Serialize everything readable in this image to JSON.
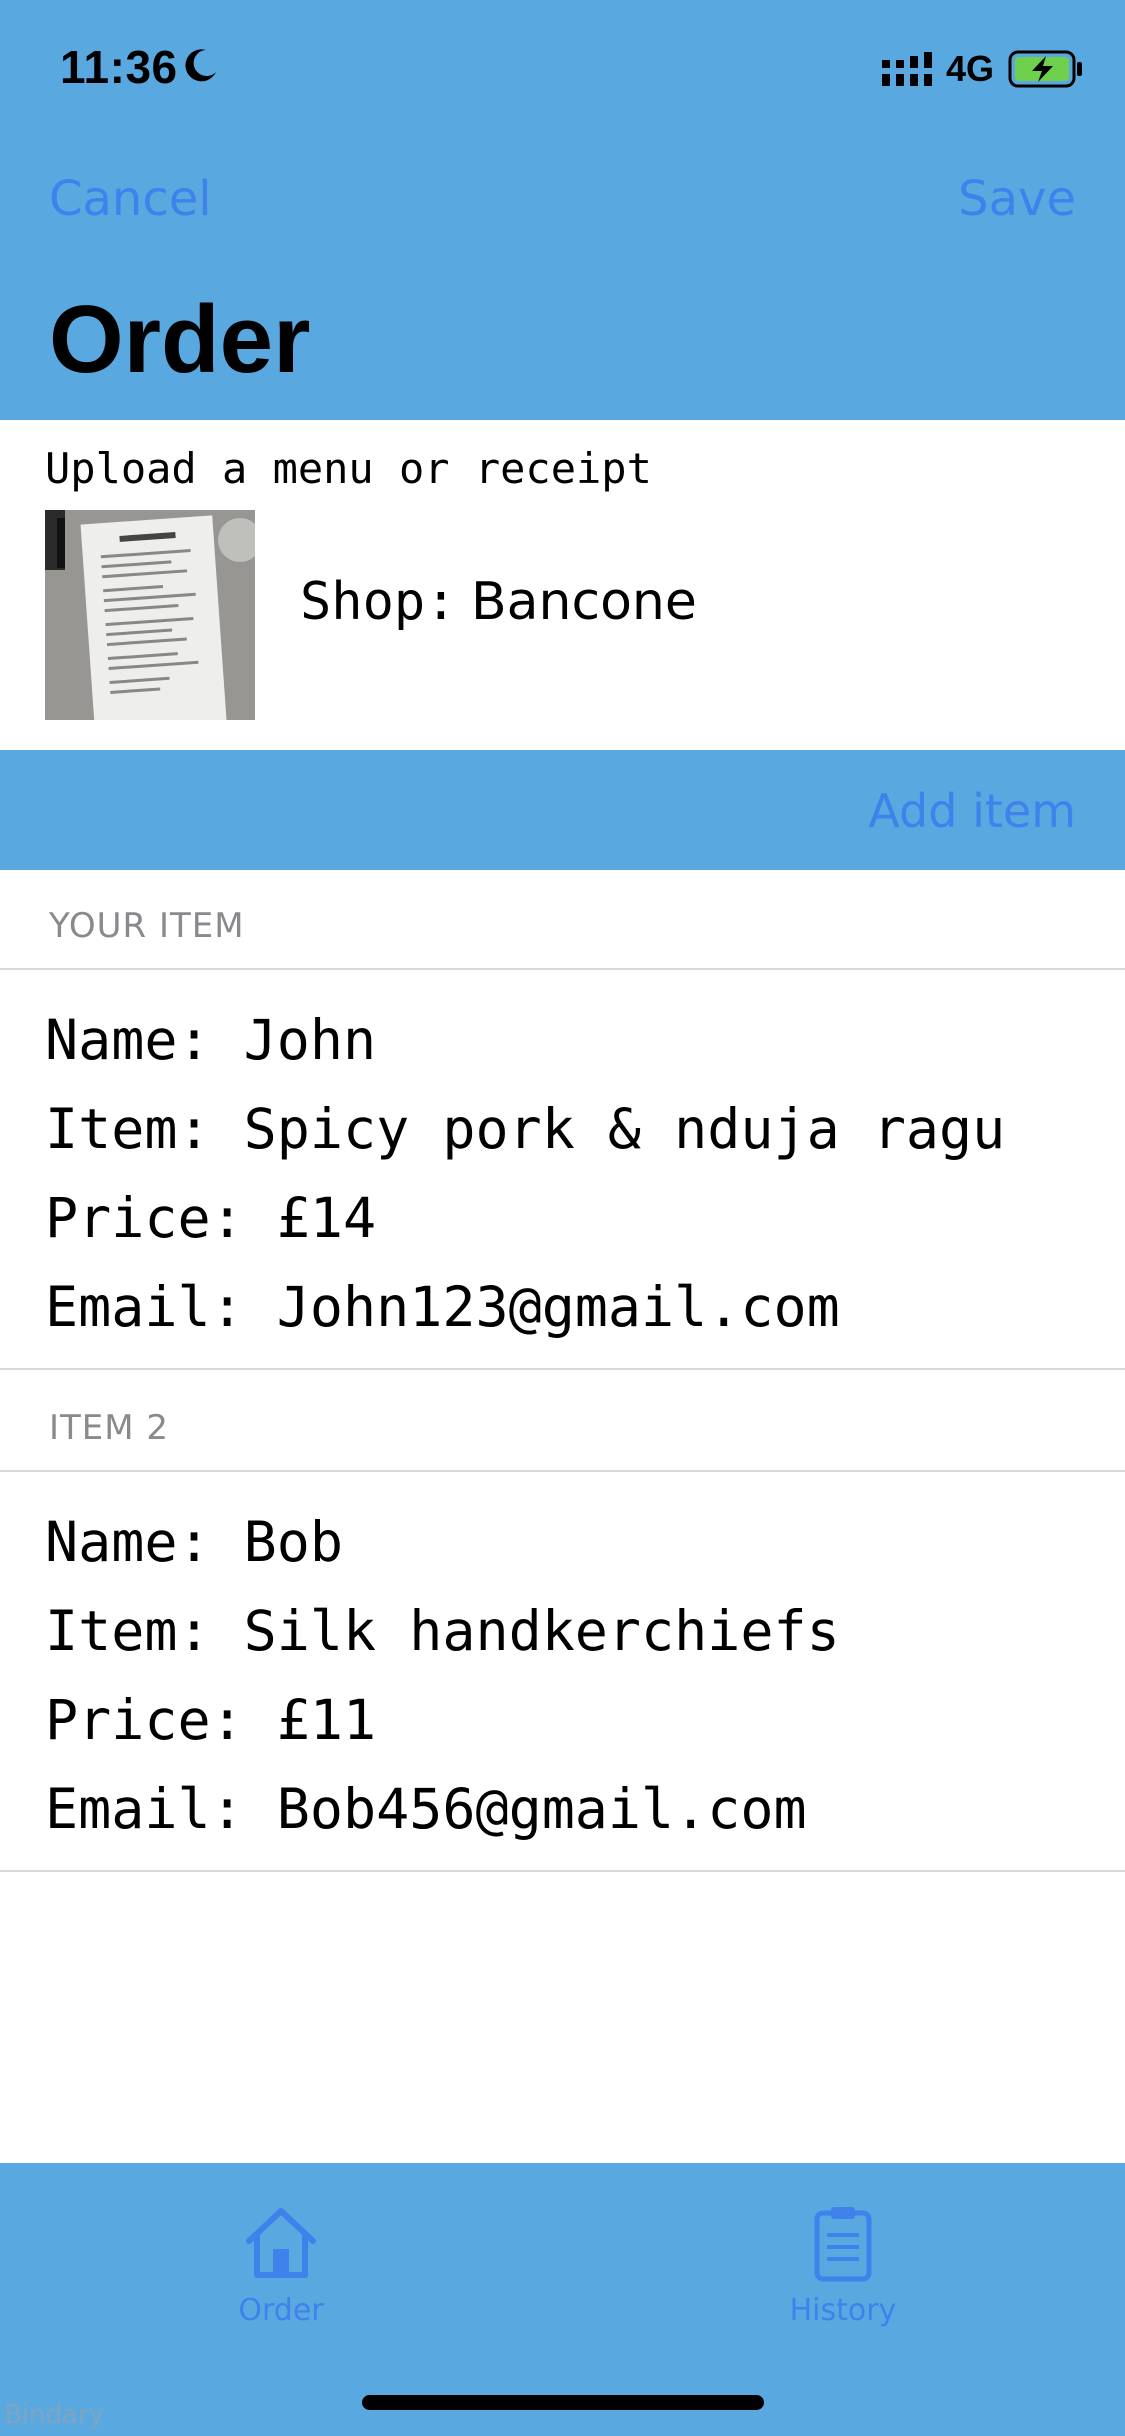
{
  "status_bar": {
    "time": "11:36",
    "network": "4G",
    "icons": [
      "moon-icon",
      "signal-icon",
      "battery-charging-icon"
    ]
  },
  "nav": {
    "cancel_label": "Cancel",
    "save_label": "Save",
    "title": "Order"
  },
  "upload": {
    "label": "Upload a menu or receipt",
    "shop_label": "Shop:",
    "shop_value": "Bancone"
  },
  "add_item_label": "Add item",
  "items": [
    {
      "header": "YOUR ITEM",
      "name": "Name: John",
      "item": "Item: Spicy pork & nduja ragu",
      "price": "Price: £14",
      "email": "Email: John123@gmail.com"
    },
    {
      "header": "ITEM 2",
      "name": "Name: Bob",
      "item": "Item: Silk handkerchiefs",
      "price": "Price: £11",
      "email": "Email: Bob456@gmail.com"
    }
  ],
  "tabs": [
    {
      "label": "Order",
      "icon": "home-icon"
    },
    {
      "label": "History",
      "icon": "clipboard-icon"
    }
  ],
  "watermark": "Bindary",
  "colors": {
    "bar_background": "#5aa8e0",
    "accent": "#3f82ec",
    "section_header_text": "#8a8a8e"
  }
}
